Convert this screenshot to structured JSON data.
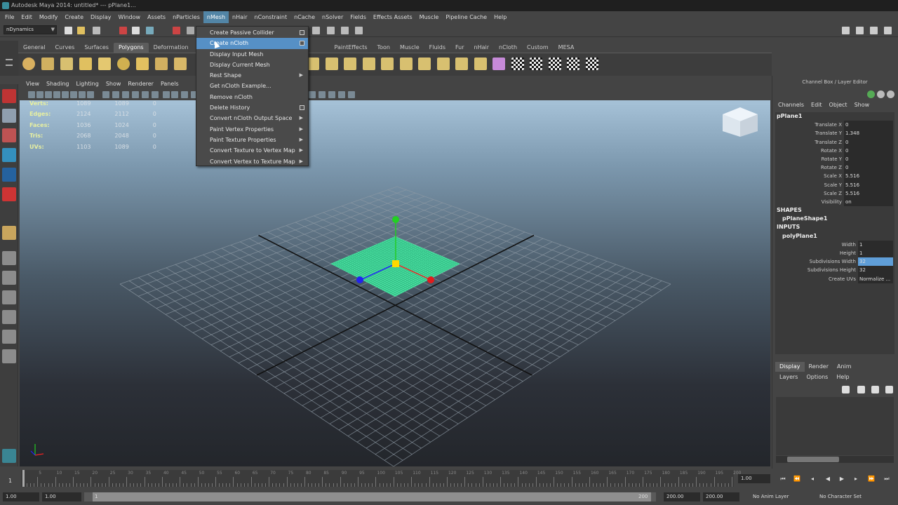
{
  "window": {
    "title": "Autodesk Maya 2014: untitled*   ---   pPlane1..."
  },
  "menubar": [
    "File",
    "Edit",
    "Modify",
    "Create",
    "Display",
    "Window",
    "Assets",
    "nParticles",
    "nMesh",
    "nHair",
    "nConstraint",
    "nCache",
    "nSolver",
    "Fields",
    "Effects Assets",
    "Muscle",
    "Pipeline Cache",
    "Help"
  ],
  "active_menu": "nMesh",
  "mode_selector": "nDynamics",
  "shelf": {
    "tabs": [
      "General",
      "Curves",
      "Surfaces",
      "Polygons",
      "Deformation",
      "PaintEffects",
      "Toon",
      "Muscle",
      "Fluids",
      "Fur",
      "nHair",
      "nCloth",
      "Custom",
      "MESA"
    ],
    "active_tab": "Polygons"
  },
  "panel_menu": [
    "View",
    "Shading",
    "Lighting",
    "Show",
    "Renderer",
    "Panels"
  ],
  "hud": {
    "rows": [
      {
        "label": "Verts:",
        "v1": "1089",
        "v2": "1089",
        "v3": "0"
      },
      {
        "label": "Edges:",
        "v1": "2124",
        "v2": "2112",
        "v3": "0"
      },
      {
        "label": "Faces:",
        "v1": "1036",
        "v2": "1024",
        "v3": "0"
      },
      {
        "label": "Tris:",
        "v1": "2068",
        "v2": "2048",
        "v3": "0"
      },
      {
        "label": "UVs:",
        "v1": "1103",
        "v2": "1089",
        "v3": "0"
      }
    ]
  },
  "nmesh_menu": {
    "items": [
      {
        "label": "Create Passive Collider",
        "option": true,
        "submenu": false
      },
      {
        "label": "Create nCloth",
        "option": true,
        "submenu": false,
        "highlighted": true
      },
      {
        "label": "Display Input Mesh",
        "option": false,
        "submenu": false
      },
      {
        "label": "Display Current Mesh",
        "option": false,
        "submenu": false
      },
      {
        "label": "Rest Shape",
        "option": false,
        "submenu": true
      },
      {
        "label": "Get nCloth Example...",
        "option": false,
        "submenu": false
      },
      {
        "label": "Remove nCloth",
        "option": false,
        "submenu": false
      },
      {
        "label": "Delete History",
        "option": true,
        "submenu": false
      },
      {
        "label": "Convert nCloth Output Space",
        "option": false,
        "submenu": true
      },
      {
        "label": "Paint Vertex Properties",
        "option": false,
        "submenu": true
      },
      {
        "label": "Paint Texture Properties",
        "option": false,
        "submenu": true
      },
      {
        "label": "Convert Texture to Vertex Map",
        "option": false,
        "submenu": true
      },
      {
        "label": "Convert Vertex to Texture Map",
        "option": false,
        "submenu": true
      }
    ]
  },
  "channel_box": {
    "title": "Channel Box / Layer Editor",
    "menu": [
      "Channels",
      "Edit",
      "Object",
      "Show"
    ],
    "object": "pPlane1",
    "attributes": [
      {
        "name": "Translate X",
        "value": "0"
      },
      {
        "name": "Translate Y",
        "value": "1.348"
      },
      {
        "name": "Translate Z",
        "value": "0"
      },
      {
        "name": "Rotate X",
        "value": "0"
      },
      {
        "name": "Rotate Y",
        "value": "0"
      },
      {
        "name": "Rotate Z",
        "value": "0"
      },
      {
        "name": "Scale X",
        "value": "5.516"
      },
      {
        "name": "Scale Y",
        "value": "5.516"
      },
      {
        "name": "Scale Z",
        "value": "5.516"
      },
      {
        "name": "Visibility",
        "value": "on"
      }
    ],
    "shapes_label": "SHAPES",
    "shape_name": "pPlaneShape1",
    "inputs_label": "INPUTS",
    "input_name": "polyPlane1",
    "input_attributes": [
      {
        "name": "Width",
        "value": "1"
      },
      {
        "name": "Height",
        "value": "1"
      },
      {
        "name": "Subdivisions Width",
        "value": "32",
        "selected": true
      },
      {
        "name": "Subdivisions Height",
        "value": "32"
      },
      {
        "name": "Create UVs",
        "value": "Normalize ..."
      }
    ]
  },
  "layer_editor": {
    "tabs": [
      "Display",
      "Render",
      "Anim"
    ],
    "active_tab": "Display",
    "menu": [
      "Layers",
      "Options",
      "Help"
    ]
  },
  "timeline": {
    "start_label": "1",
    "current_frame": "1.00",
    "ticks": [
      "5",
      "10",
      "15",
      "20",
      "25",
      "30",
      "35",
      "40",
      "45",
      "50",
      "55",
      "60",
      "65",
      "70",
      "75",
      "80",
      "85",
      "90",
      "95",
      "100",
      "105",
      "110",
      "115",
      "120",
      "125",
      "130",
      "135",
      "140",
      "145",
      "150",
      "155",
      "160",
      "165",
      "170",
      "175",
      "180",
      "185",
      "190",
      "195",
      "200"
    ]
  },
  "range": {
    "start": "1.00",
    "start2": "1.00",
    "slider_start": "1",
    "slider_end": "200",
    "end": "200.00",
    "end2": "200.00",
    "anim_layer": "No Anim Layer",
    "char_set": "No Character Set"
  }
}
